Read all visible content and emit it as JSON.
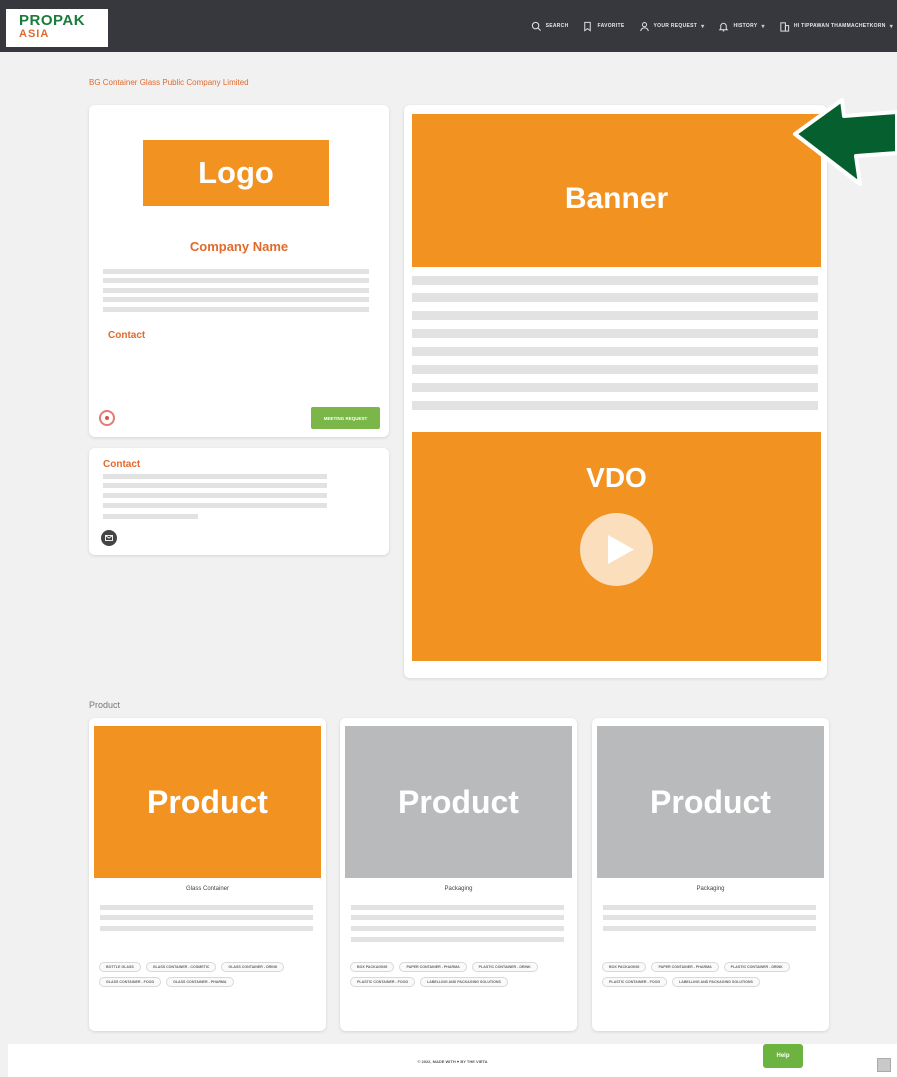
{
  "brand": {
    "name_top": "PROPAK",
    "name_bottom": "ASIA",
    "green": "#1b7b3a",
    "orange": "#e2692b"
  },
  "nav": {
    "items": [
      {
        "icon": "search-icon",
        "label": "Search"
      },
      {
        "icon": "bookmark-icon",
        "label": "Favorite"
      },
      {
        "icon": "user-icon",
        "label": "Your Request"
      },
      {
        "icon": "bell-icon",
        "label": "History"
      },
      {
        "icon": "building-icon",
        "label": "Hi Tippawan Thammachetkorn"
      }
    ]
  },
  "company_heading": "BG Container Glass Public Company Limited",
  "profile": {
    "logo_placeholder": "Logo",
    "company_name": "Company Name",
    "contact_label": "Contact",
    "meeting_button": "Meeting Request"
  },
  "contact_card": {
    "label": "Contact"
  },
  "media": {
    "banner_placeholder": "Banner",
    "video_placeholder": "VDO"
  },
  "products_section": {
    "label": "Product",
    "items": [
      {
        "placeholder": "Product",
        "category": "Glass Container",
        "highlight": true,
        "tags": [
          "Bottle Glass",
          "Glass Container - Cosmetic",
          "Glass Container - Drink",
          "Glass Container - Food",
          "Glass Container - Pharma"
        ]
      },
      {
        "placeholder": "Product",
        "category": "Packaging",
        "highlight": false,
        "tags": [
          "Box Packaging",
          "Paper Container - Pharma",
          "Plastic Container - Drink",
          "Plastic Container - Food",
          "Labelling and Packaging Solutions"
        ]
      },
      {
        "placeholder": "Product",
        "category": "Packaging",
        "highlight": false,
        "tags": [
          "Box Packaging",
          "Paper Container - Pharma",
          "Plastic Container - Drink",
          "Plastic Container - Food",
          "Labelling and Packaging Solutions"
        ]
      }
    ]
  },
  "footer": {
    "text": "© 2022, Made with ♥ by the Vieta"
  },
  "help_button": "Help",
  "colors": {
    "placeholder_orange": "#f29221",
    "placeholder_gray": "#b9babc",
    "arrow_green": "#055f2e",
    "meeting_green": "#7ab648"
  }
}
